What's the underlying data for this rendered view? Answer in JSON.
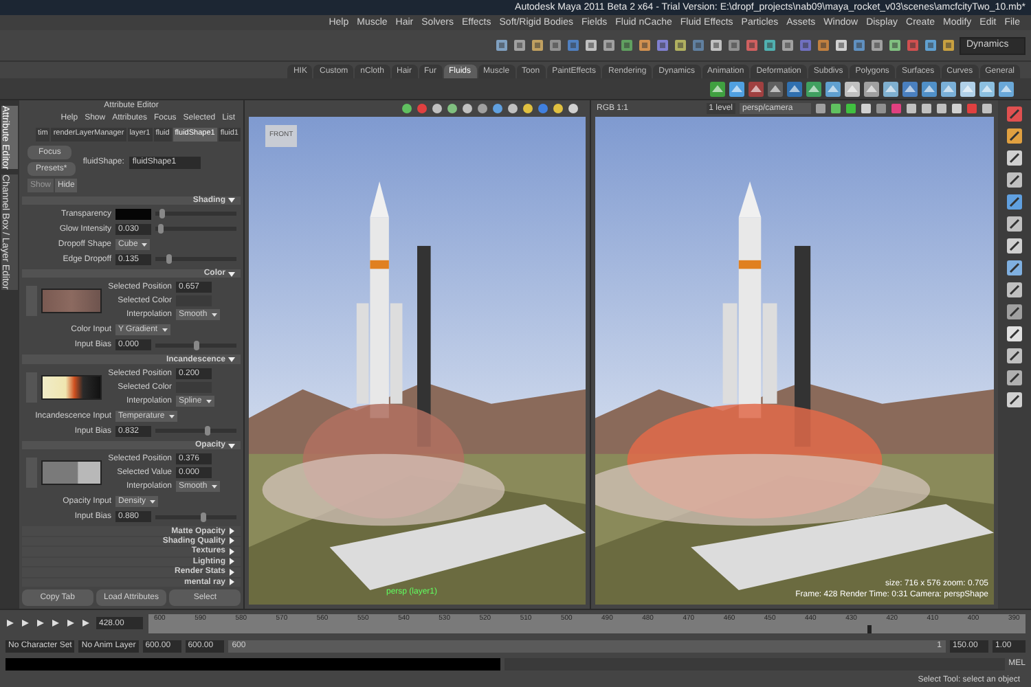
{
  "window": {
    "title": "Autodesk Maya 2011 Beta 2 x64 - Trial Version: E:\\dropf_projects\\nab09\\maya_rocket_v03\\scenes\\amcfcityTwo_10.mb*"
  },
  "menu_bar": [
    "Help",
    "Muscle",
    "Hair",
    "Solvers",
    "Effects",
    "Soft/Rigid Bodies",
    "Fields",
    "Fluid nCache",
    "Fluid Effects",
    "Particles",
    "Assets",
    "Window",
    "Display",
    "Create",
    "Modify",
    "Edit",
    "File"
  ],
  "status_line": {
    "menu_set": "Dynamics"
  },
  "shelf_tabs": [
    {
      "label": "HIK",
      "selected": false
    },
    {
      "label": "Custom",
      "selected": false
    },
    {
      "label": "nCloth",
      "selected": false
    },
    {
      "label": "Hair",
      "selected": false
    },
    {
      "label": "Fur",
      "selected": false
    },
    {
      "label": "Fluids",
      "selected": true
    },
    {
      "label": "Muscle",
      "selected": false
    },
    {
      "label": "Toon",
      "selected": false
    },
    {
      "label": "PaintEffects",
      "selected": false
    },
    {
      "label": "Rendering",
      "selected": false
    },
    {
      "label": "Dynamics",
      "selected": false
    },
    {
      "label": "Animation",
      "selected": false
    },
    {
      "label": "Deformation",
      "selected": false
    },
    {
      "label": "Subdivs",
      "selected": false
    },
    {
      "label": "Polygons",
      "selected": false
    },
    {
      "label": "Surfaces",
      "selected": false
    },
    {
      "label": "Curves",
      "selected": false
    },
    {
      "label": "General",
      "selected": false
    }
  ],
  "side_tabs": [
    {
      "label": "Attribute Editor",
      "selected": true
    },
    {
      "label": "Channel Box / Layer Editor",
      "selected": false
    }
  ],
  "attribute_editor": {
    "title": "Attribute Editor",
    "menu": [
      "Help",
      "Show",
      "Attributes",
      "Focus",
      "Selected",
      "List"
    ],
    "tabs": [
      {
        "label": "tim",
        "selected": false
      },
      {
        "label": "renderLayerManager",
        "selected": false
      },
      {
        "label": "layer1",
        "selected": false
      },
      {
        "label": "fluid",
        "selected": false
      },
      {
        "label": "fluidShape1",
        "selected": true
      },
      {
        "label": "fluid1",
        "selected": false
      }
    ],
    "buttons": [
      "Focus",
      "Presets*",
      "Show",
      "Hide"
    ],
    "node_label": "fluidShape:",
    "node_name": "fluidShape1",
    "sections": [
      {
        "title": "Shading",
        "expanded": true,
        "rows": [
          {
            "kind": "color",
            "label": "Transparency",
            "level": 0.05
          },
          {
            "kind": "float",
            "label": "Glow Intensity",
            "value": "0.030",
            "level": 0.03
          },
          {
            "kind": "enum",
            "label": "Dropoff Shape",
            "value": "Cube"
          },
          {
            "kind": "float",
            "label": "Edge Dropoff",
            "value": "0.135",
            "level": 0.14
          }
        ]
      },
      {
        "title": "Color",
        "expanded": true,
        "rows": [
          {
            "kind": "ramp",
            "fields": [
              {
                "kind": "float",
                "label": "Selected Position",
                "value": "0.657"
              },
              {
                "kind": "color",
                "label": "Selected Color"
              },
              {
                "kind": "enum",
                "label": "Interpolation",
                "value": "Smooth"
              }
            ]
          },
          {
            "kind": "enum",
            "label": "Color Input",
            "value": "Y Gradient"
          },
          {
            "kind": "float",
            "label": "Input Bias",
            "value": "0.000",
            "level": 0.5
          }
        ]
      },
      {
        "title": "Incandescence",
        "expanded": true,
        "rows": [
          {
            "kind": "ramp",
            "fields": [
              {
                "kind": "float",
                "label": "Selected Position",
                "value": "0.200"
              },
              {
                "kind": "color",
                "label": "Selected Color"
              },
              {
                "kind": "enum",
                "label": "Interpolation",
                "value": "Spline"
              }
            ]
          },
          {
            "kind": "enum",
            "label": "Incandescence Input",
            "value": "Temperature"
          },
          {
            "kind": "float",
            "label": "Input Bias",
            "value": "0.832",
            "level": 0.65
          }
        ]
      },
      {
        "title": "Opacity",
        "expanded": true,
        "rows": [
          {
            "kind": "ramp",
            "fields": [
              {
                "kind": "float",
                "label": "Selected Position",
                "value": "0.376"
              },
              {
                "kind": "float",
                "label": "Selected Value",
                "value": "0.000"
              },
              {
                "kind": "enum",
                "label": "Interpolation",
                "value": "Smooth"
              }
            ]
          },
          {
            "kind": "enum",
            "label": "Opacity Input",
            "value": "Density"
          },
          {
            "kind": "float",
            "label": "Input Bias",
            "value": "0.880",
            "level": 0.6
          }
        ]
      },
      {
        "title": "Matte Opacity",
        "expanded": false
      },
      {
        "title": "Shading Quality",
        "expanded": false
      },
      {
        "title": "Textures",
        "expanded": false
      },
      {
        "title": "Lighting",
        "expanded": false
      },
      {
        "title": "Render Stats",
        "expanded": false
      },
      {
        "title": "mental ray",
        "expanded": false
      }
    ],
    "footer_buttons": [
      "Copy Tab",
      "Load Attributes",
      "Select"
    ]
  },
  "viewport": {
    "camera_label": "FRONT",
    "caption": "persp (layer1)"
  },
  "render_view": {
    "display": "RGB 1:1",
    "layer": "1 level",
    "camera_field": "persp/camera",
    "info_lines": [
      "size: 716 x 576 zoom: 0.705",
      "Frame: 428  Render Time: 0:31  Camera: perspShape"
    ]
  },
  "timeline": {
    "ticks": [
      "600",
      "590",
      "580",
      "570",
      "560",
      "550",
      "540",
      "530",
      "520",
      "510",
      "500",
      "490",
      "480",
      "470",
      "460",
      "450",
      "440",
      "430",
      "420",
      "410",
      "400",
      "390"
    ],
    "current_frame": "428.00",
    "level": 0.82
  },
  "range": {
    "start_time": "1.00",
    "playback_start": "150.00",
    "slider_start": "1",
    "slider_end": "600",
    "level": 1,
    "playback_end": "600.00",
    "end_time": "600.00",
    "anim_layer": "No Anim Layer",
    "character_set": "No Character Set"
  },
  "command_line": {
    "label": "MEL"
  },
  "help_line": "Select Tool: select an object"
}
